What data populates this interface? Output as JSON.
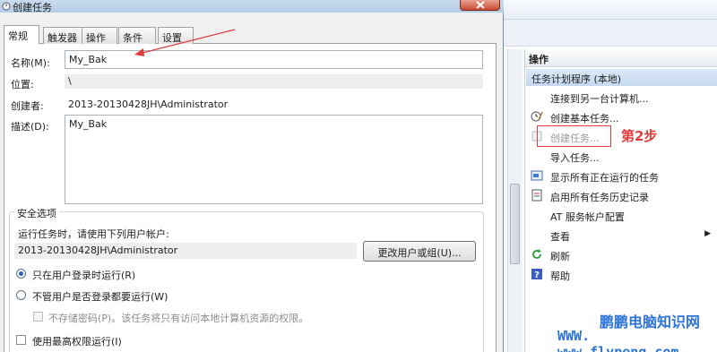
{
  "dialog": {
    "title": "创建任务",
    "tabs": [
      {
        "label": "常规",
        "active": true
      },
      {
        "label": "触发器",
        "active": false
      },
      {
        "label": "操作",
        "active": false
      },
      {
        "label": "条件",
        "active": false
      },
      {
        "label": "设置",
        "active": false
      }
    ],
    "name_label": "名称(M):",
    "name_value": "My_Bak",
    "location_label": "位置:",
    "location_value": "\\",
    "author_label": "创建者:",
    "author_value": "2013-20130428JH\\Administrator",
    "description_label": "描述(D):",
    "description_value": "My_Bak",
    "security": {
      "legend": "安全选项",
      "run_as_prompt": "运行任务时，请使用下列用户帐户:",
      "account_value": "2013-20130428JH\\Administrator",
      "change_user_button": "更改用户或组(U)...",
      "radio_logged_on": "只在用户登录时运行(R)",
      "radio_logged_on_checked": true,
      "radio_whether_logged": "不管用户是否登录都要运行(W)",
      "radio_whether_logged_checked": false,
      "no_store_password": "不存储密码(P)。该任务将只有访问本地计算机资源的权限。",
      "highest_privileges": "使用最高权限运行(I)"
    }
  },
  "actions_pane": {
    "header": "操作",
    "group_title": "任务计划程序 (本地)",
    "items": [
      {
        "label": "连接到另一台计算机...",
        "icon": "none-icon",
        "disabled": false
      },
      {
        "label": "创建基本任务...",
        "icon": "clock-wand-icon",
        "disabled": false
      },
      {
        "label": "创建任务...",
        "icon": "new-task-icon",
        "disabled": true
      },
      {
        "label": "导入任务...",
        "icon": "none-icon",
        "disabled": false
      },
      {
        "label": "显示所有正在运行的任务",
        "icon": "running-tasks-icon",
        "disabled": false
      },
      {
        "label": "启用所有任务历史记录",
        "icon": "history-icon",
        "disabled": false
      },
      {
        "label": "AT 服务帐户配置",
        "icon": "none-icon",
        "disabled": false
      },
      {
        "label": "查看",
        "icon": "none-icon",
        "disabled": false,
        "submenu": true
      },
      {
        "label": "刷新",
        "icon": "refresh-icon",
        "disabled": false
      },
      {
        "label": "帮助",
        "icon": "help-icon",
        "disabled": false
      }
    ]
  },
  "annotation": {
    "step_label": "第2步",
    "color": "#e03b3b"
  },
  "watermark": {
    "site_name": "鹏鹏电脑知识网",
    "url": "WWW. www.flypeng.com",
    "color": "#2d74d8"
  }
}
